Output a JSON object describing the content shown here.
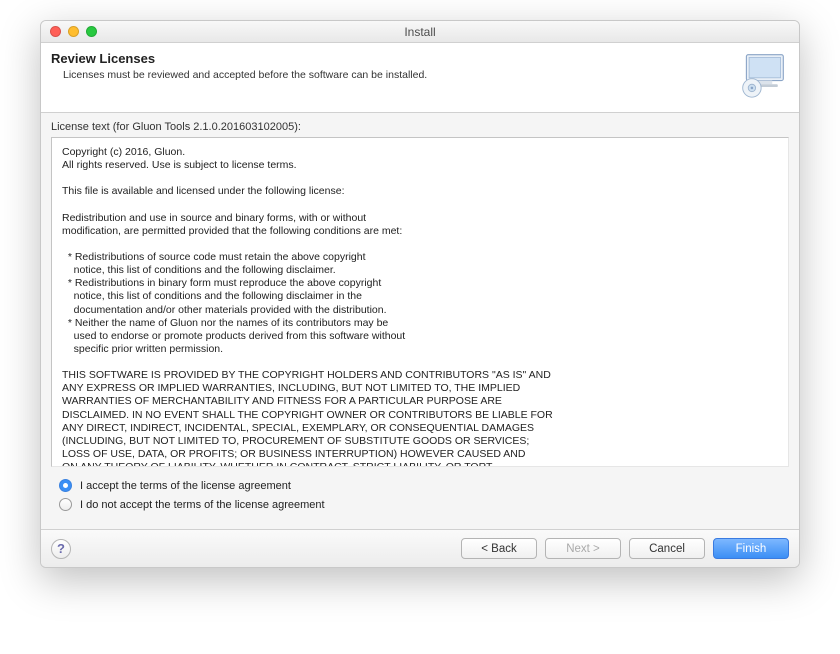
{
  "titlebar": {
    "title": "Install"
  },
  "header": {
    "title": "Review Licenses",
    "subtitle": "Licenses must be reviewed and accepted before the software can be installed."
  },
  "license": {
    "label": "License text (for Gluon Tools 2.1.0.201603102005):",
    "text": "Copyright (c) 2016, Gluon.\nAll rights reserved. Use is subject to license terms.\n\nThis file is available and licensed under the following license:\n\nRedistribution and use in source and binary forms, with or without\nmodification, are permitted provided that the following conditions are met:\n\n  * Redistributions of source code must retain the above copyright\n    notice, this list of conditions and the following disclaimer.\n  * Redistributions in binary form must reproduce the above copyright\n    notice, this list of conditions and the following disclaimer in the\n    documentation and/or other materials provided with the distribution.\n  * Neither the name of Gluon nor the names of its contributors may be\n    used to endorse or promote products derived from this software without\n    specific prior written permission.\n\nTHIS SOFTWARE IS PROVIDED BY THE COPYRIGHT HOLDERS AND CONTRIBUTORS \"AS IS\" AND\nANY EXPRESS OR IMPLIED WARRANTIES, INCLUDING, BUT NOT LIMITED TO, THE IMPLIED\nWARRANTIES OF MERCHANTABILITY AND FITNESS FOR A PARTICULAR PURPOSE ARE\nDISCLAIMED. IN NO EVENT SHALL THE COPYRIGHT OWNER OR CONTRIBUTORS BE LIABLE FOR\nANY DIRECT, INDIRECT, INCIDENTAL, SPECIAL, EXEMPLARY, OR CONSEQUENTIAL DAMAGES\n(INCLUDING, BUT NOT LIMITED TO, PROCUREMENT OF SUBSTITUTE GOODS OR SERVICES;\nLOSS OF USE, DATA, OR PROFITS; OR BUSINESS INTERRUPTION) HOWEVER CAUSED AND\nON ANY THEORY OF LIABILITY, WHETHER IN CONTRACT, STRICT LIABILITY, OR TORT\n(INCLUDING NEGLIGENCE OR OTHERWISE) ARISING IN ANY WAY OUT OF THE USE OF THIS\nSOFTWARE, EVEN IF ADVISED OF THE POSSIBILITY OF SUCH DAMAGE."
  },
  "radios": {
    "accept": "I accept the terms of the license agreement",
    "reject": "I do not accept the terms of the license agreement",
    "selected": "accept"
  },
  "buttons": {
    "back": "< Back",
    "next": "Next >",
    "cancel": "Cancel",
    "finish": "Finish"
  }
}
